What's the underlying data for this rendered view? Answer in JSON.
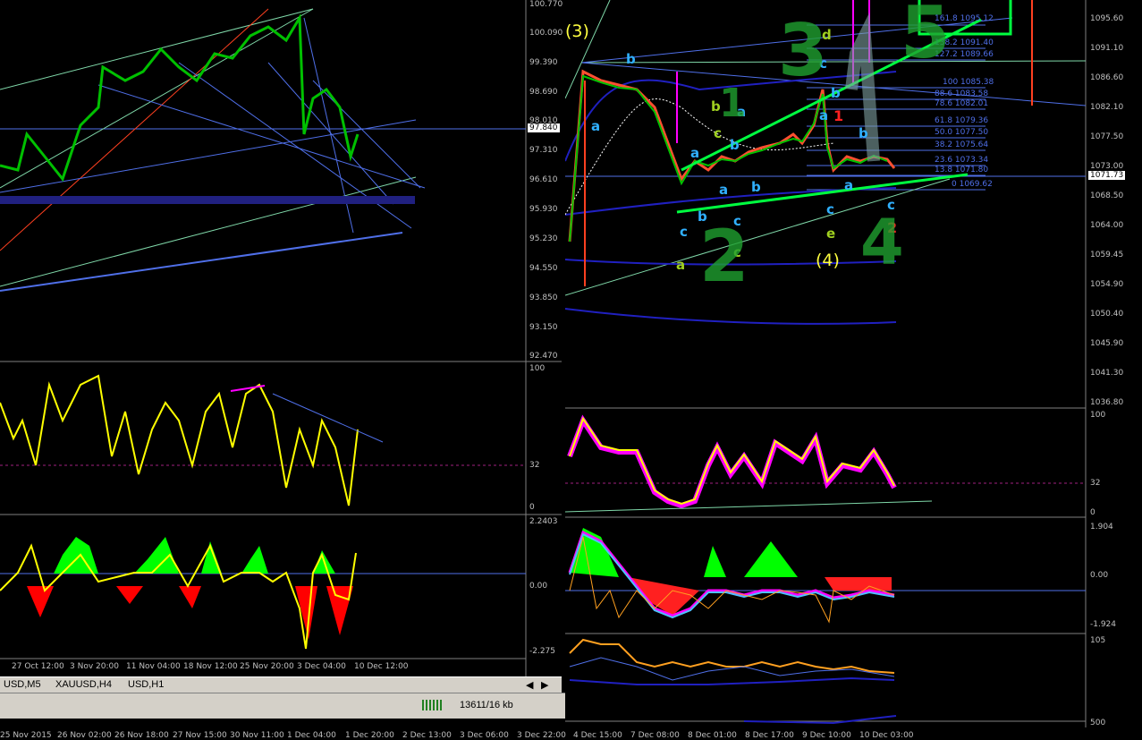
{
  "left_chart": {
    "price_scale": [
      "100.770",
      "100.090",
      "99.390",
      "98.690",
      "98.010",
      "97.310",
      "96.610",
      "95.930",
      "95.230",
      "94.550",
      "93.850",
      "93.150",
      "92.470"
    ],
    "current_price": "97.840",
    "rsi_scale": [
      "100",
      "32",
      "0"
    ],
    "macd_scale": [
      "2.2403",
      "0.00",
      "-2.275"
    ],
    "time_labels": [
      "27 Oct 12:00",
      "3 Nov 20:00",
      "11 Nov 04:00",
      "18 Nov 12:00",
      "25 Nov 20:00",
      "3 Dec 04:00",
      "10 Dec 12:00"
    ]
  },
  "right_chart": {
    "price_scale": [
      "1095.60",
      "1091.10",
      "1086.60",
      "1082.10",
      "1077.50",
      "1073.00",
      "1068.50",
      "1064.00",
      "1059.45",
      "1054.90",
      "1050.40",
      "1045.90",
      "1041.30",
      "1036.80"
    ],
    "current_price": "1071.73",
    "fib_levels": [
      "161.8 1095.12",
      "138.2 1091.40",
      "127.2 1089.66",
      "100 1085.38",
      "88.6 1083.58",
      "78.6 1082.01",
      "61.8 1079.36",
      "50.0 1077.50",
      "38.2 1075.64",
      "23.6 1073.34",
      "13.8 1071.80",
      "0 1069.62"
    ],
    "rsi_scale": [
      "100",
      "32",
      "0"
    ],
    "macd_scale": [
      "1.904",
      "0.00",
      "-1.924"
    ],
    "band_scale": [
      "105",
      "500"
    ],
    "wave_labels": [
      "(3)",
      "(4)",
      "a",
      "b",
      "c",
      "d",
      "e"
    ],
    "handwritten_numbers": [
      "1",
      "2",
      "3",
      "4",
      "5"
    ],
    "red_labels": [
      "1",
      "2"
    ]
  },
  "bottom_time_labels": [
    "25 Nov 2015",
    "26 Nov 02:00",
    "26 Nov 18:00",
    "27 Nov 15:00",
    "30 Nov 11:00",
    "1 Dec 04:00",
    "1 Dec 20:00",
    "2 Dec 13:00",
    "3 Dec 06:00",
    "3 Dec 22:00",
    "4 Dec 15:00",
    "7 Dec 08:00",
    "8 Dec 01:00",
    "8 Dec 17:00",
    "9 Dec 10:00",
    "10 Dec 03:00"
  ],
  "tabs": [
    "USD,M5",
    "XAUUSD,H4",
    "USD,H1"
  ],
  "status": {
    "traffic": "13611/16 kb"
  },
  "colors": {
    "bull": "#00ff00",
    "bear": "#ff0000",
    "rsi": "#ffff00",
    "fib": "#4f6fe8",
    "trend": "#00ff00"
  }
}
